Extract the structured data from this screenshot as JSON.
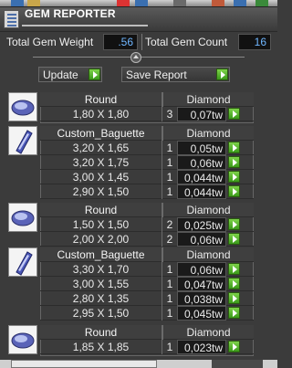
{
  "window": {
    "title": "GEM REPORTER"
  },
  "stats": {
    "weight_label": "Total Gem Weight",
    "weight_value": ".56",
    "count_label": "Total Gem Count",
    "count_value": "16"
  },
  "toolbar": {
    "update_label": "Update",
    "save_label": "Save Report"
  },
  "groups": [
    {
      "icon": "round-gem-icon",
      "cut": "Round",
      "material": "Diamond",
      "rows": [
        {
          "dim": "1,80 X 1,80",
          "qty": "3",
          "wt": "0,07tw"
        }
      ]
    },
    {
      "icon": "baguette-gem-icon",
      "cut": "Custom_Baguette",
      "material": "Diamond",
      "rows": [
        {
          "dim": "3,20 X 1,65",
          "qty": "1",
          "wt": "0,05tw"
        },
        {
          "dim": "3,20 X 1,75",
          "qty": "1",
          "wt": "0,06tw"
        },
        {
          "dim": "3,00 X 1,45",
          "qty": "1",
          "wt": "0,044tw"
        },
        {
          "dim": "2,90 X 1,50",
          "qty": "1",
          "wt": "0,044tw"
        }
      ]
    },
    {
      "icon": "round-gem-icon",
      "cut": "Round",
      "material": "Diamond",
      "rows": [
        {
          "dim": "1,50 X 1,50",
          "qty": "2",
          "wt": "0,025tw"
        },
        {
          "dim": "2,00 X 2,00",
          "qty": "2",
          "wt": "0,06tw"
        }
      ]
    },
    {
      "icon": "baguette-gem-icon",
      "cut": "Custom_Baguette",
      "material": "Diamond",
      "rows": [
        {
          "dim": "3,30 X 1,70",
          "qty": "1",
          "wt": "0,06tw"
        },
        {
          "dim": "3,00 X 1,55",
          "qty": "1",
          "wt": "0,047tw"
        },
        {
          "dim": "2,80 X 1,35",
          "qty": "1",
          "wt": "0,038tw"
        },
        {
          "dim": "2,95 X 1,50",
          "qty": "1",
          "wt": "0,045tw"
        }
      ]
    },
    {
      "icon": "round-gem-icon",
      "cut": "Round",
      "material": "Diamond",
      "rows": [
        {
          "dim": "1,85 X 1,85",
          "qty": "1",
          "wt": "0,023tw"
        }
      ]
    }
  ]
}
